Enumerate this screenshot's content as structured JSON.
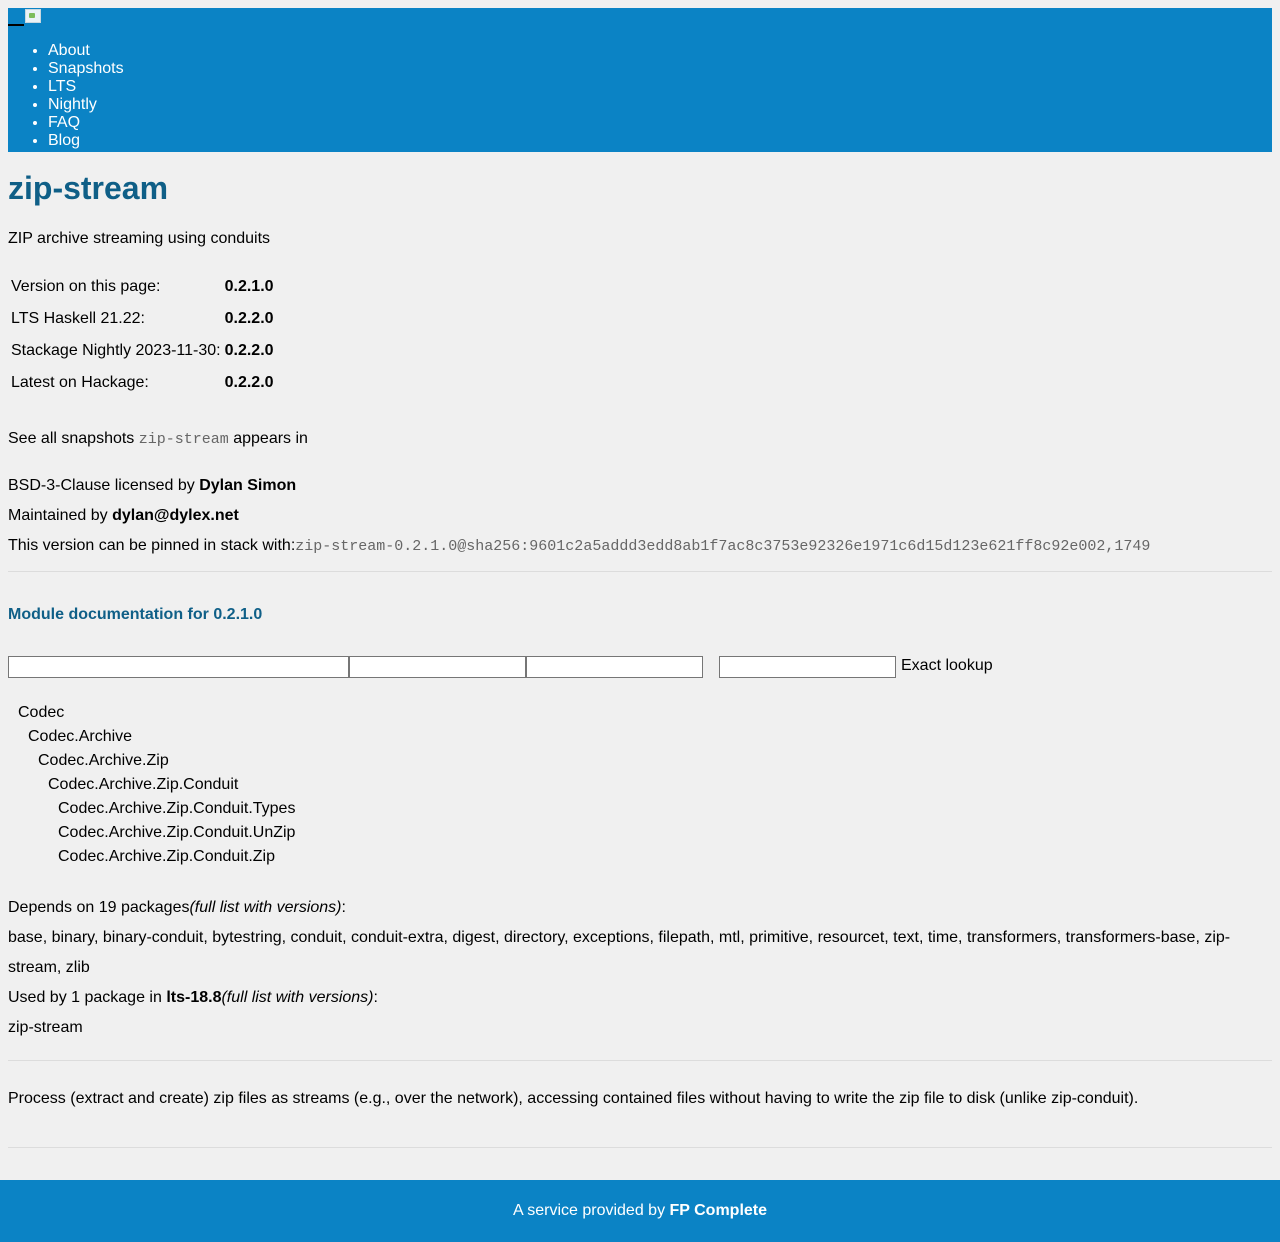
{
  "nav": {
    "items": [
      "About",
      "Snapshots",
      "LTS",
      "Nightly",
      "FAQ",
      "Blog"
    ]
  },
  "package": {
    "name": "zip-stream",
    "synopsis": "ZIP archive streaming using conduits"
  },
  "versions": [
    {
      "label": "Version on this page:",
      "value": "0.2.1.0"
    },
    {
      "label": "LTS Haskell 21.22:",
      "value": "0.2.2.0"
    },
    {
      "label": "Stackage Nightly 2023-11-30:",
      "value": "0.2.2.0"
    },
    {
      "label": "Latest on Hackage:",
      "value": "0.2.2.0"
    }
  ],
  "snapshots": {
    "prefix": "See all snapshots",
    "package_code": "zip-stream",
    "suffix": "appears in"
  },
  "license": {
    "prefix": "BSD-3-Clause licensed by",
    "author": "Dylan Simon"
  },
  "maintainer": {
    "prefix": "Maintained by",
    "email": "dylan@dylex.net"
  },
  "pin": {
    "prefix": "This version can be pinned in stack with:",
    "value": "zip-stream-0.2.1.0@sha256:9601c2a5addd3edd8ab1f7ac8c3753e92326e1971c6d15d123e621ff8c92e002,1749"
  },
  "module_doc": {
    "heading": "Module documentation for 0.2.1.0",
    "exact_lookup": "Exact lookup",
    "modules": [
      {
        "name": "Codec",
        "depth": 0
      },
      {
        "name": "Codec.Archive",
        "depth": 1
      },
      {
        "name": "Codec.Archive.Zip",
        "depth": 2
      },
      {
        "name": "Codec.Archive.Zip.Conduit",
        "depth": 3
      },
      {
        "name": "Codec.Archive.Zip.Conduit.Types",
        "depth": 4
      },
      {
        "name": "Codec.Archive.Zip.Conduit.UnZip",
        "depth": 4
      },
      {
        "name": "Codec.Archive.Zip.Conduit.Zip",
        "depth": 4
      }
    ]
  },
  "depends": {
    "prefix": "Depends on 19 packages",
    "full_list": "(full list with versions)",
    "suffix": ":",
    "packages": "base, binary, binary-conduit, bytestring, conduit, conduit-extra, digest, directory, exceptions, filepath, mtl, primitive, resourcet, text, time, transformers, transformers-base, zip-stream, zlib"
  },
  "used_by": {
    "prefix": "Used by 1 package in",
    "snapshot": "lts-18.8",
    "full_list": "(full list with versions)",
    "suffix": ":",
    "packages": "zip-stream"
  },
  "description": "Process (extract and create) zip files as streams (e.g., over the network), accessing contained files without having to write the zip file to disk (unlike zip-conduit).",
  "footer": {
    "prefix": "A service provided by",
    "company": "FP Complete"
  },
  "colors": {
    "header_bg": "#0b83c5",
    "title": "#0f5f87",
    "page_bg": "#f0f0f0"
  }
}
